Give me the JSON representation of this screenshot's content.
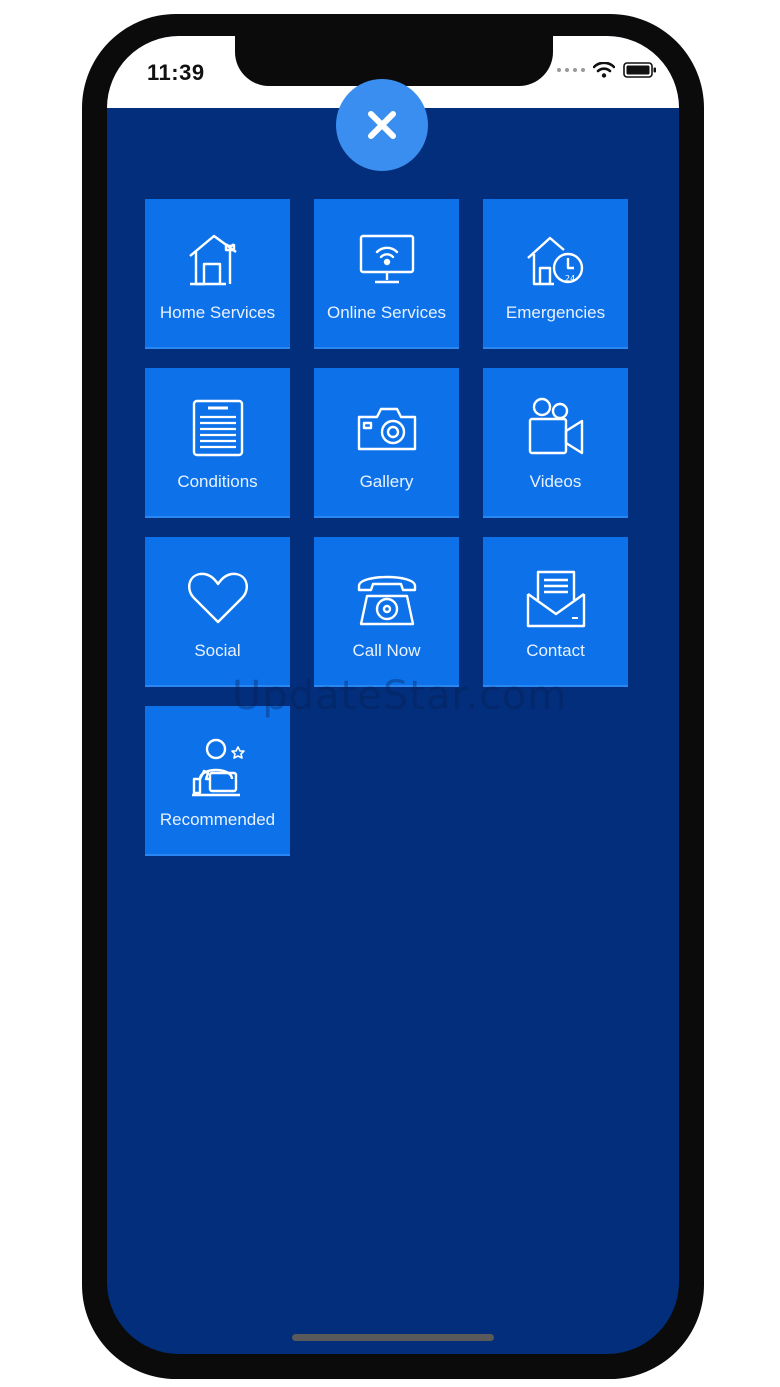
{
  "status_bar": {
    "time": "11:39",
    "icons": [
      "signal-dots-icon",
      "wifi-icon",
      "battery-icon"
    ]
  },
  "close_button": {
    "icon": "close-icon"
  },
  "menu": {
    "tiles": [
      {
        "label": "Home Services",
        "icon": "house-wrench-icon"
      },
      {
        "label": "Online Services",
        "icon": "monitor-wifi-icon"
      },
      {
        "label": "Emergencies",
        "icon": "house-24h-icon"
      },
      {
        "label": "Conditions",
        "icon": "document-terms-icon"
      },
      {
        "label": "Gallery",
        "icon": "camera-icon"
      },
      {
        "label": "Videos",
        "icon": "video-camera-icon"
      },
      {
        "label": "Social",
        "icon": "heart-icon"
      },
      {
        "label": "Call Now",
        "icon": "telephone-icon"
      },
      {
        "label": "Contact",
        "icon": "envelope-letter-icon"
      },
      {
        "label": "Recommended",
        "icon": "person-thumbs-up-icon"
      }
    ]
  },
  "watermark": "UpdateStar.com",
  "colors": {
    "background": "#032e7c",
    "tile": "#0d72ea",
    "close_button": "#3a8ef0",
    "text": "#e8f1ff"
  }
}
